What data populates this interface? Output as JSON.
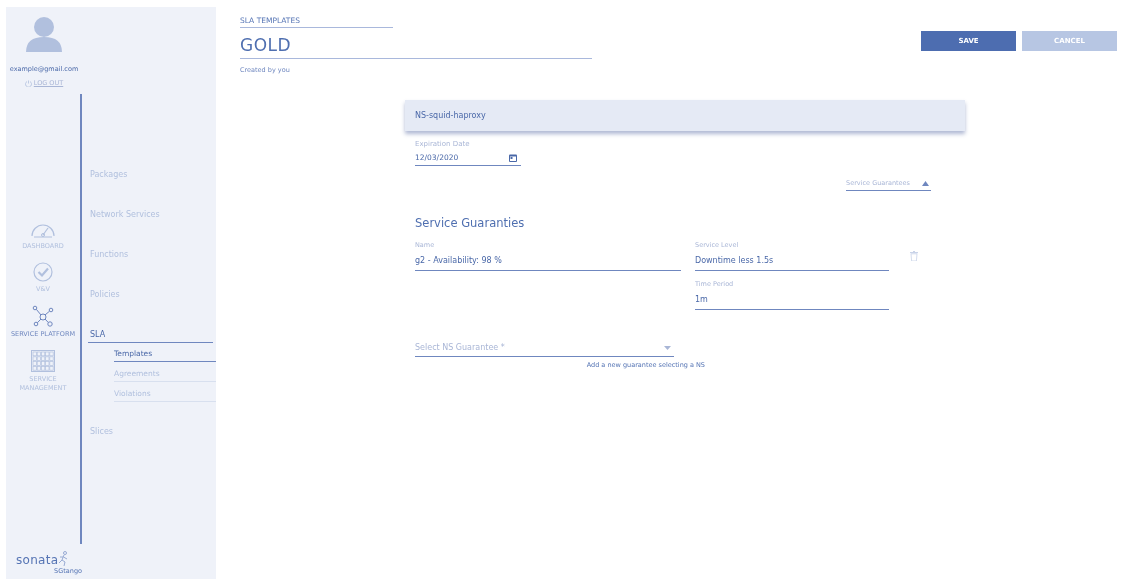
{
  "user": {
    "email": "example@gmail.com",
    "logout": "LOG OUT"
  },
  "rail": [
    {
      "kind": "gauge",
      "label": "DASHBOARD",
      "selected": false
    },
    {
      "kind": "check",
      "label": "V&V",
      "selected": false
    },
    {
      "kind": "network",
      "label": "SERVICE PLATFORM",
      "selected": true
    },
    {
      "kind": "grid",
      "label": "SERVICE MANAGEMENT",
      "selected": false
    }
  ],
  "nav": [
    {
      "label": "Packages",
      "selected": false
    },
    {
      "label": "Network Services",
      "selected": false
    },
    {
      "label": "Functions",
      "selected": false
    },
    {
      "label": "Policies",
      "selected": false
    },
    {
      "label": "SLA",
      "selected": true,
      "expanded": true,
      "children": [
        {
          "label": "Templates",
          "selected": true
        },
        {
          "label": "Agreements",
          "selected": false
        },
        {
          "label": "Violations",
          "selected": false
        }
      ]
    },
    {
      "label": "Slices",
      "selected": false
    }
  ],
  "logo": {
    "name": "sonata",
    "tagline": "SGtango"
  },
  "header": {
    "section": "SLA TEMPLATES",
    "title": "GOLD",
    "subtitle": "Created by you"
  },
  "buttons": [
    {
      "label": "SAVE",
      "kind": "primary"
    },
    {
      "label": "CANCEL",
      "kind": "secondary"
    }
  ],
  "form": {
    "network_service_option": "NS-squid-haproxy",
    "expiration": {
      "label": "Expiration Date",
      "value": "12/03/2020"
    },
    "guarantees_toggle": {
      "label": "Service Guarantees",
      "expanded": true
    },
    "section_title": "Service Guaranties",
    "guarantee": {
      "name_label": "Name",
      "name": "g2 - Availability: 98 %",
      "level_label": "Service Level",
      "level": "Downtime less 1.5s",
      "period_label": "Time Period",
      "period": "1m"
    },
    "select": {
      "placeholder": "Select NS Guarantee *",
      "hint": "Add a new guarantee selecting a NS"
    }
  }
}
